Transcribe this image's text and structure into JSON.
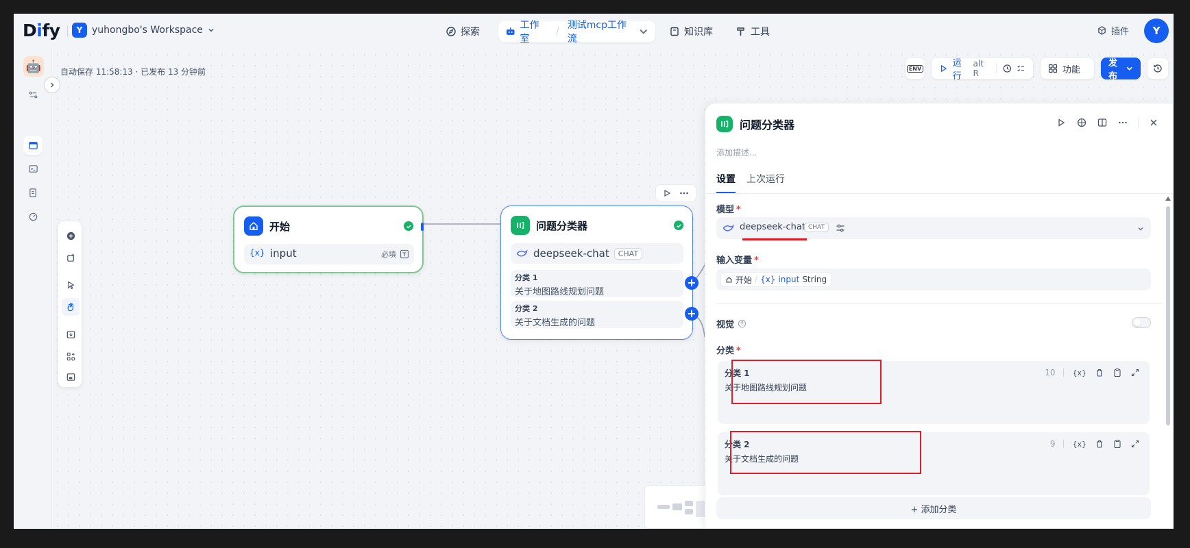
{
  "brand": {
    "logo_text_a": "D",
    "logo_text_b": "i",
    "logo_text_c": "fy"
  },
  "workspace": {
    "avatar_letter": "Y",
    "name": "yuhongbo's Workspace"
  },
  "nav": {
    "explore": "探索",
    "studio": "工作室",
    "current_app": "测试mcp工作流",
    "knowledge": "知识库",
    "tools": "工具"
  },
  "plugins_label": "插件",
  "user_avatar_letter": "Y",
  "canvas": {
    "autosave_text": "自动保存 11:58:13 · 已发布 13 分钟前"
  },
  "toolbar": {
    "env_label": "ENV",
    "run_label": "运行",
    "run_shortcut": "alt R",
    "features_label": "功能",
    "publish_label": "发布"
  },
  "start_node": {
    "title": "开始",
    "var_symbol": "{x}",
    "var_name": "input",
    "required_label": "必填"
  },
  "classifier_node": {
    "title": "问题分类器",
    "model": "deepseek-chat",
    "model_badge": "CHAT",
    "classes": [
      {
        "title": "分类 1",
        "desc": "关于地图路线规划问题"
      },
      {
        "title": "分类 2",
        "desc": "关于文档生成的问题"
      }
    ]
  },
  "panel": {
    "title": "问题分类器",
    "description_placeholder": "添加描述...",
    "tabs": [
      "设置",
      "上次运行"
    ],
    "model_label": "模型",
    "model_name": "deepseek-chat",
    "model_badge": "CHAT",
    "input_label": "输入变量",
    "input_source": "开始",
    "input_var_symbol": "{x}",
    "input_var": "input",
    "input_type": "String",
    "vision_label": "视觉",
    "class_label": "分类",
    "classes": [
      {
        "title": "分类 1",
        "desc": "关于地图路线规划问题",
        "count": "10"
      },
      {
        "title": "分类 2",
        "desc": "关于文档生成的问题",
        "count": "9"
      }
    ],
    "var_action": "{x}",
    "add_class_label": "+ 添加分类"
  },
  "colors": {
    "accent": "#155eef",
    "success": "#17b26a",
    "annotation": "#e31b23"
  }
}
